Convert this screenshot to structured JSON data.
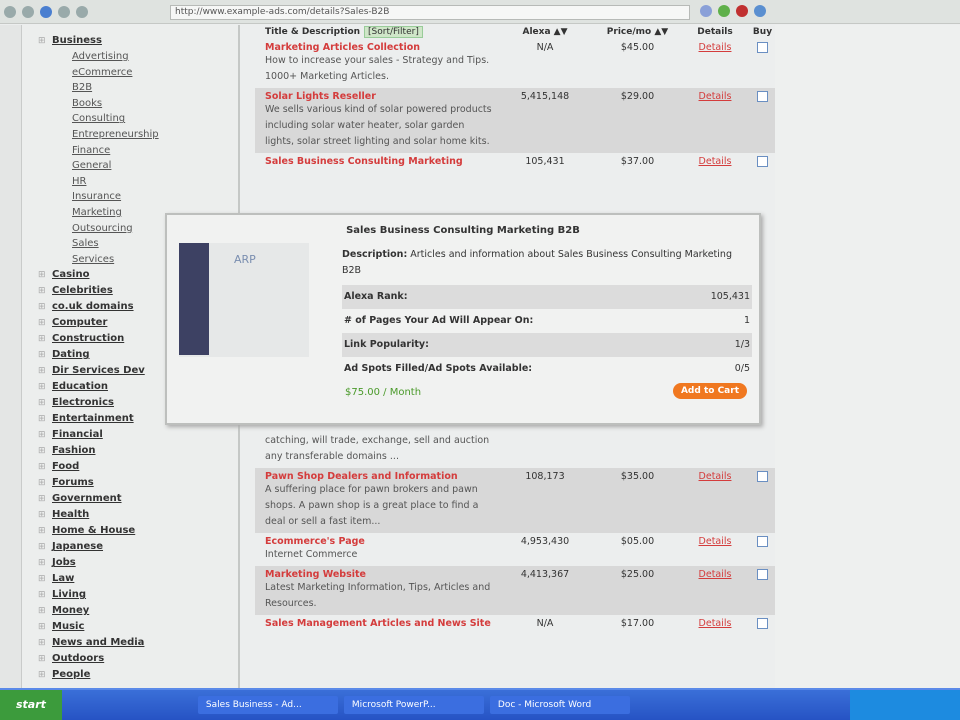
{
  "browser": {
    "url": "http://www.example-ads.com/details?Sales-B2B"
  },
  "sidebar": {
    "top_cat": "Business",
    "subs": [
      "Advertising",
      "eCommerce",
      "B2B",
      "Books",
      "Consulting",
      "Entrepreneurship",
      "Finance",
      "General",
      "HR",
      "Insurance",
      "Marketing",
      "Outsourcing",
      "Sales",
      "Services"
    ],
    "cats": [
      "Casino",
      "Celebrities",
      "co.uk domains",
      "Computer",
      "Construction",
      "Dating",
      "Dir Services Dev",
      "Education",
      "Electronics",
      "Entertainment",
      "Financial",
      "Fashion",
      "Food",
      "Forums",
      "Government",
      "Health",
      "Home & House",
      "Japanese",
      "Jobs",
      "Law",
      "Living",
      "Money",
      "Music",
      "News and Media",
      "Outdoors",
      "People"
    ]
  },
  "table": {
    "headers": {
      "title": "Title & Description",
      "sort": "[Sort/Filter]",
      "alexa": "Alexa ▲▼",
      "price": "Price/mo ▲▼",
      "details": "Details",
      "buy": "Buy"
    },
    "rows_top": [
      {
        "title": "Marketing Articles Collection",
        "desc": "How to increase your sales - Strategy and Tips. 1000+ Marketing Articles.",
        "alexa": "N/A",
        "price": "$45.00",
        "details": "Details"
      },
      {
        "title": "Solar Lights Reseller",
        "desc": "We sells various kind of solar powered products including solar water heater, solar garden lights, solar street lighting and solar home kits.",
        "alexa": "5,415,148",
        "price": "$29.00",
        "details": "Details"
      },
      {
        "title": "Sales Business Consulting Marketing",
        "desc": "",
        "alexa": "105,431",
        "price": "$37.00",
        "details": "Details"
      }
    ],
    "continuation": "catching, will trade, exchange, sell and auction any transferable domains ...",
    "rows_bottom": [
      {
        "title": "Pawn Shop Dealers and Information",
        "desc": "A suffering place for pawn brokers and pawn shops. A pawn shop is a great place to find a deal or sell a fast item...",
        "alexa": "108,173",
        "price": "$35.00",
        "details": "Details"
      },
      {
        "title": "Ecommerce's Page",
        "desc": "Internet Commerce",
        "alexa": "4,953,430",
        "price": "$05.00",
        "details": "Details"
      },
      {
        "title": "Marketing Website",
        "desc": "Latest Marketing Information, Tips, Articles and Resources.",
        "alexa": "4,413,367",
        "price": "$25.00",
        "details": "Details"
      },
      {
        "title": "Sales Management Articles and News Site",
        "desc": "",
        "alexa": "N/A",
        "price": "$17.00",
        "details": "Details"
      }
    ]
  },
  "popup": {
    "title": "Sales Business Consulting Marketing B2B",
    "desc_label": "Description:",
    "desc": "Articles and information about Sales Business Consulting Marketing B2B",
    "fields": [
      {
        "label": "Alexa Rank:",
        "value": "105,431"
      },
      {
        "label": "# of Pages Your Ad Will Appear On:",
        "value": "1"
      },
      {
        "label": "Link Popularity:",
        "value": "1/3"
      },
      {
        "label": "Ad Spots Filled/Ad Spots Available:",
        "value": "0/5"
      }
    ],
    "price": "$75.00 / Month",
    "button": "Add to Cart",
    "thumb_logo": "ARP"
  },
  "taskbar": {
    "start": "start",
    "tasks": [
      "Sales Business - Ad...",
      "Microsoft PowerP...",
      "Doc - Microsoft Word"
    ]
  }
}
